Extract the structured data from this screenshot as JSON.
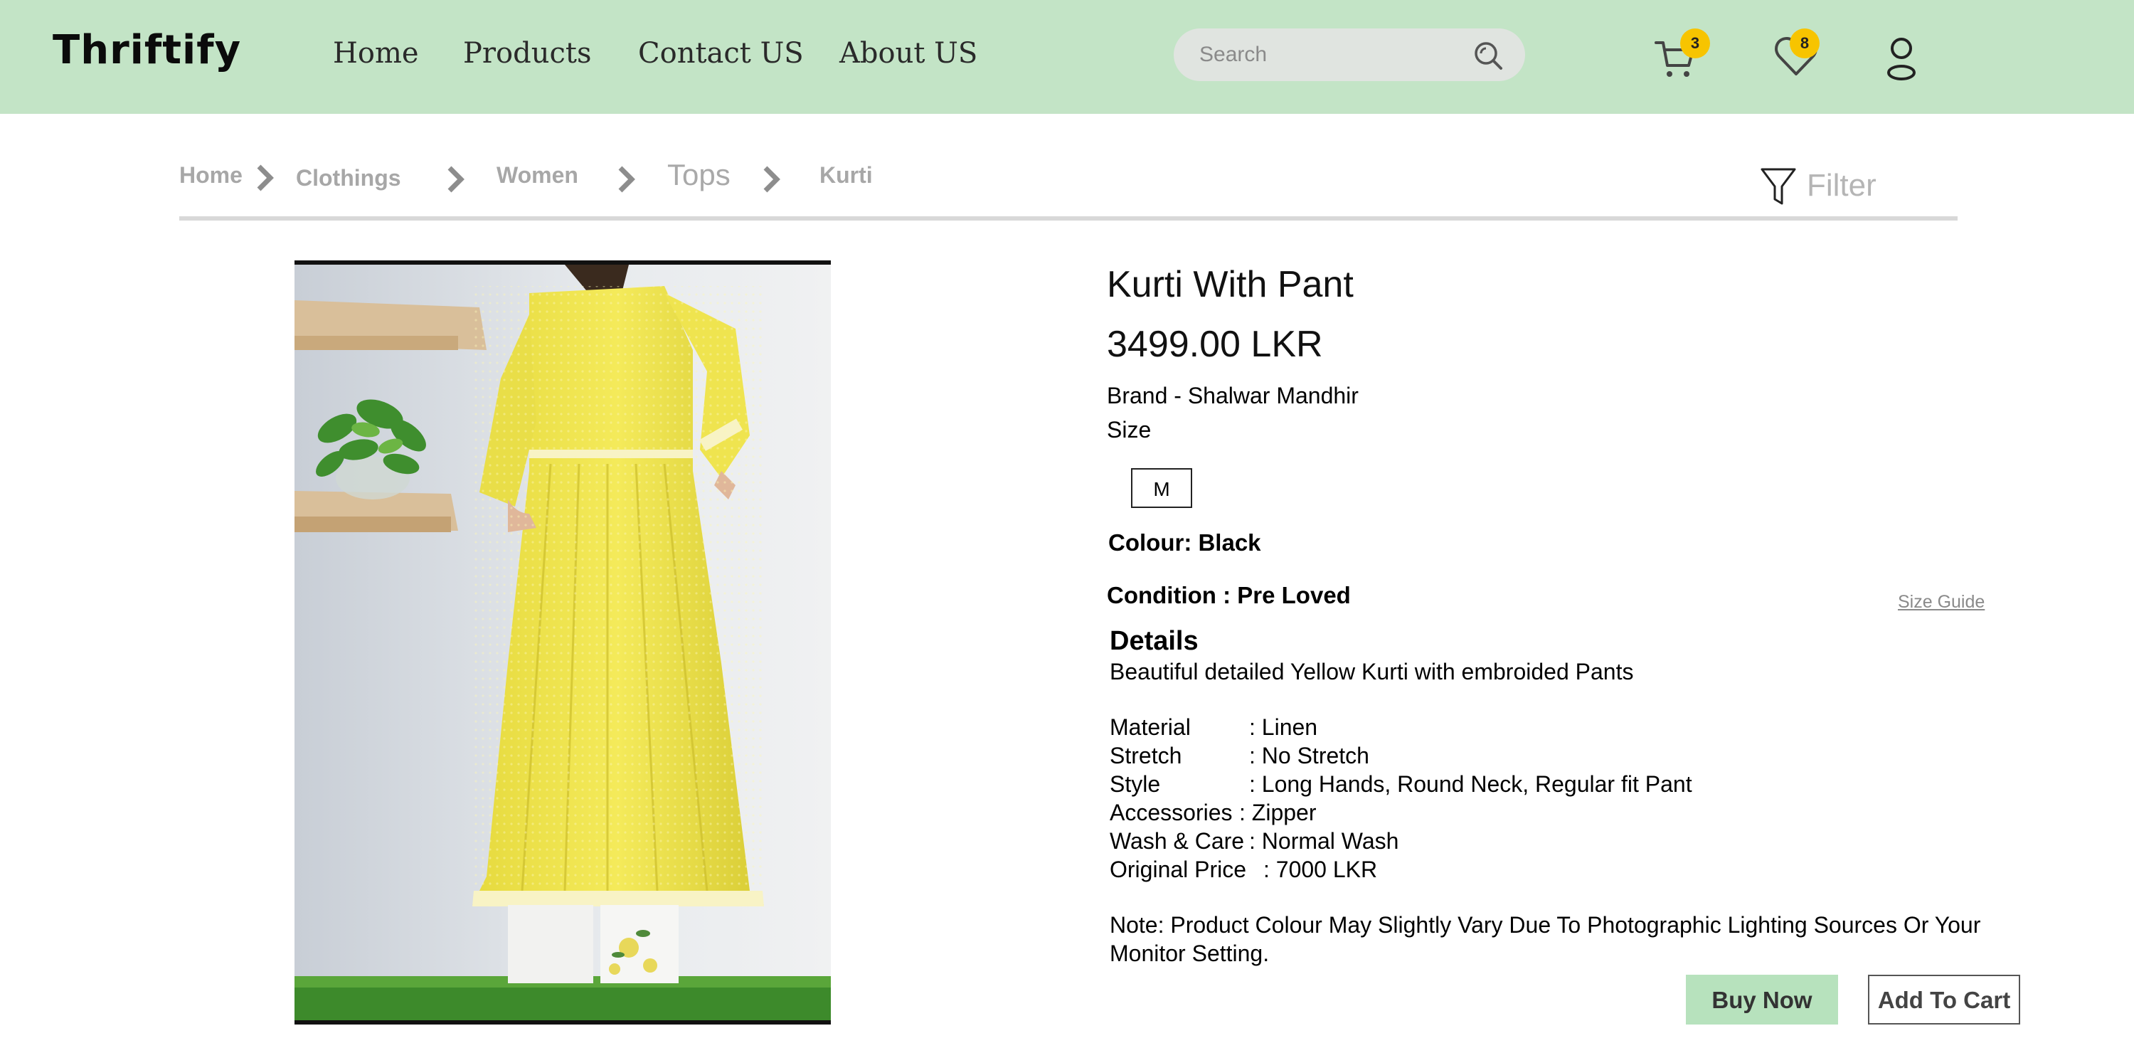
{
  "header": {
    "logo": "Thriftify",
    "nav": [
      "Home",
      "Products",
      "Contact US",
      "About US"
    ],
    "search_placeholder": "Search",
    "cart_count": "3",
    "wishlist_count": "8"
  },
  "breadcrumb": [
    "Home",
    "Clothings",
    "Women",
    "Tops",
    "Kurti"
  ],
  "filter_label": "Filter",
  "product": {
    "title": "Kurti With Pant",
    "price": "3499.00 LKR",
    "brand": "Brand - Shalwar Mandhir",
    "size_label": "Size",
    "size_option": "M",
    "colour": "Colour: Black",
    "condition": "Condition : Pre Loved",
    "size_guide": "Size Guide",
    "details_heading": "Details",
    "description": "Beautiful detailed Yellow Kurti with embroided Pants",
    "specs": [
      {
        "key": "Material",
        "value": ": Linen"
      },
      {
        "key": "Stretch",
        "value": ": No Stretch"
      },
      {
        "key": "Style",
        "value": ": Long Hands, Round Neck, Regular fit Pant"
      },
      {
        "key": "Accessories",
        "value": " : Zipper"
      },
      {
        "key": "Wash & Care",
        "value": ": Normal Wash"
      },
      {
        "key": "Original Price",
        "value": ": 7000 LKR"
      }
    ],
    "note": "Note: Product Colour May Slightly Vary Due To Photographic Lighting Sources Or Your Monitor Setting."
  },
  "actions": {
    "buy_now": "Buy Now",
    "add_to_cart": "Add To Cart"
  },
  "colors": {
    "header_bg": "#c3e4c6",
    "badge": "#f7c400",
    "buy_button": "#b7e2bd"
  }
}
